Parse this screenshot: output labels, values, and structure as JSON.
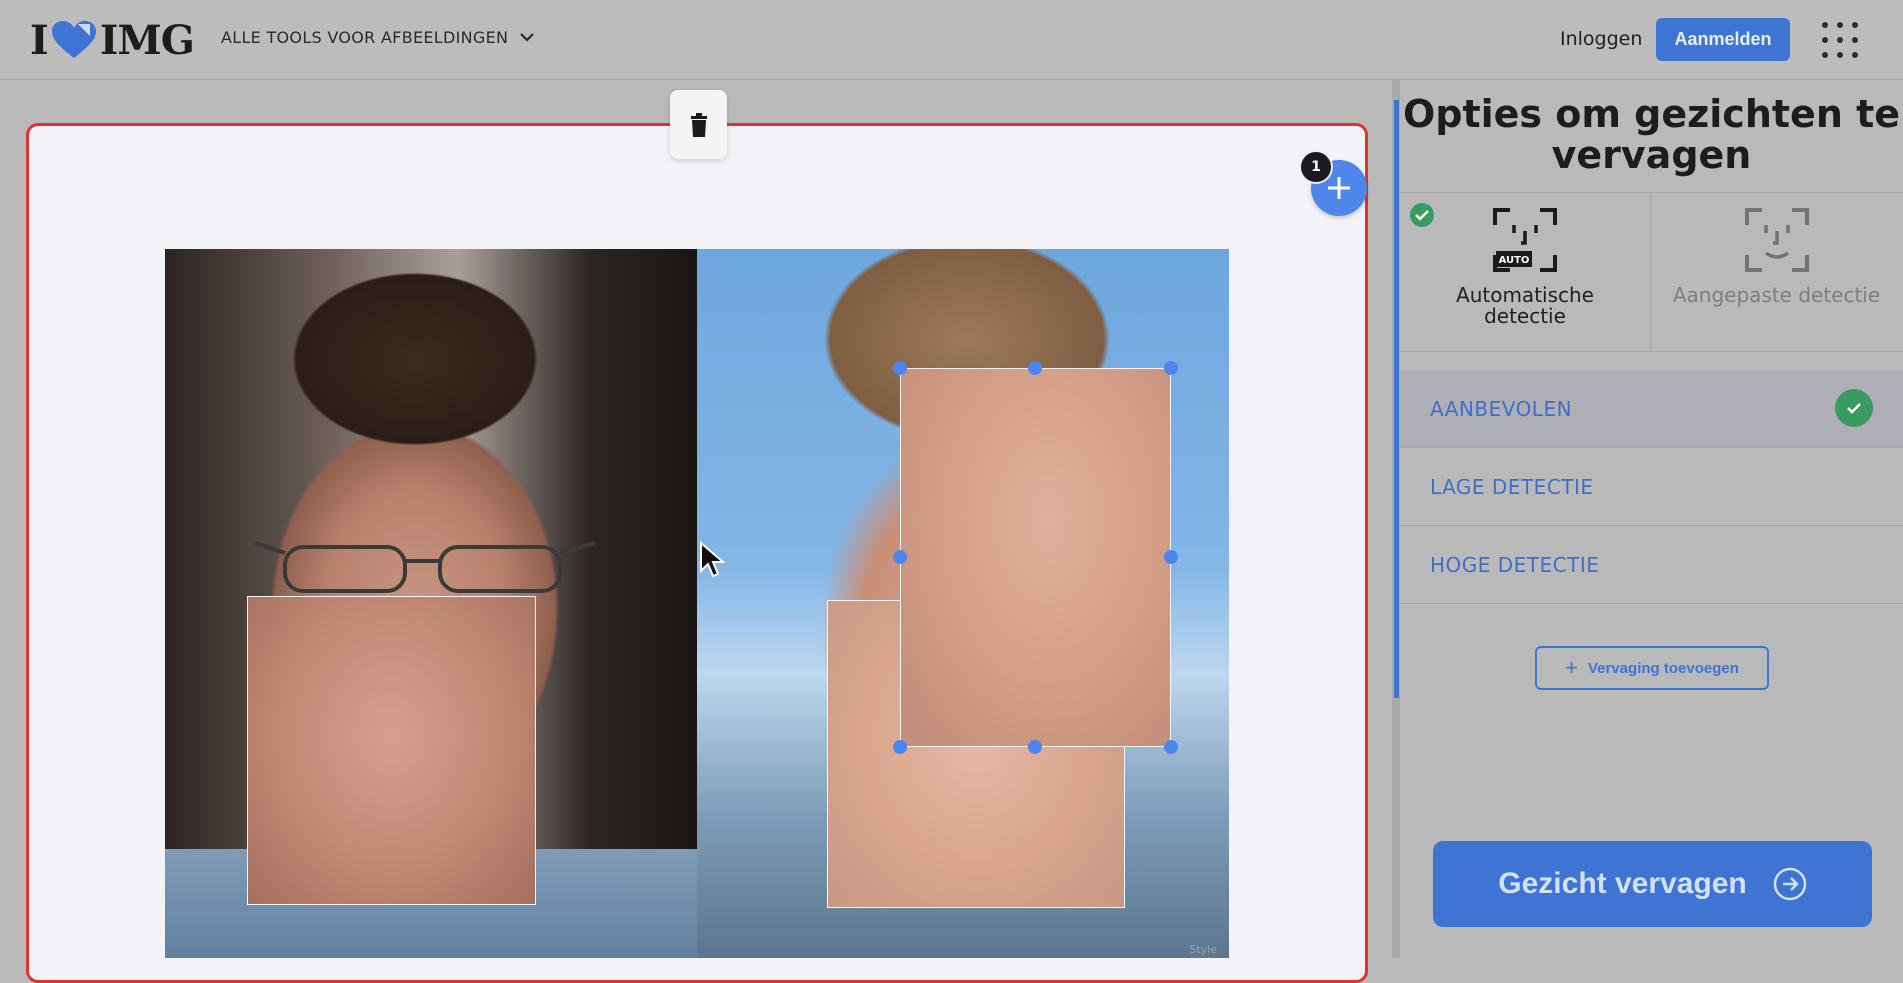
{
  "header": {
    "logo_left": "I",
    "logo_right": "IMG",
    "tools_menu_label": "ALLE TOOLS VOOR AFBEELDINGEN",
    "login_label": "Inloggen",
    "signup_label": "Aanmelden",
    "icons": {
      "heart": "heart-icon",
      "chevron": "chevron-down-icon",
      "apps": "apps-grid-icon"
    }
  },
  "editor": {
    "face_count_badge": "1",
    "icons": {
      "trash": "trash-icon",
      "add": "plus-icon"
    },
    "watermark": "Style",
    "frame_color": "#e3322c"
  },
  "panel": {
    "title": "Opties om gezichten te vervagen",
    "detection_tabs": [
      {
        "label": "Automatische detectie",
        "icon": "auto-face-detect-icon",
        "icon_badge": "AUTO",
        "selected": true
      },
      {
        "label": "Aangepaste detectie",
        "icon": "custom-face-detect-icon",
        "selected": false
      }
    ],
    "options": [
      {
        "label": "AANBEVOLEN",
        "selected": true
      },
      {
        "label": "LAGE DETECTIE",
        "selected": false
      },
      {
        "label": "HOGE DETECTIE",
        "selected": false
      }
    ],
    "add_replacement_label": "Vervaging toevoegen",
    "cta_label": "Gezicht vervagen",
    "accent_color": "#3e74d4",
    "check_color": "#3a9b61"
  }
}
